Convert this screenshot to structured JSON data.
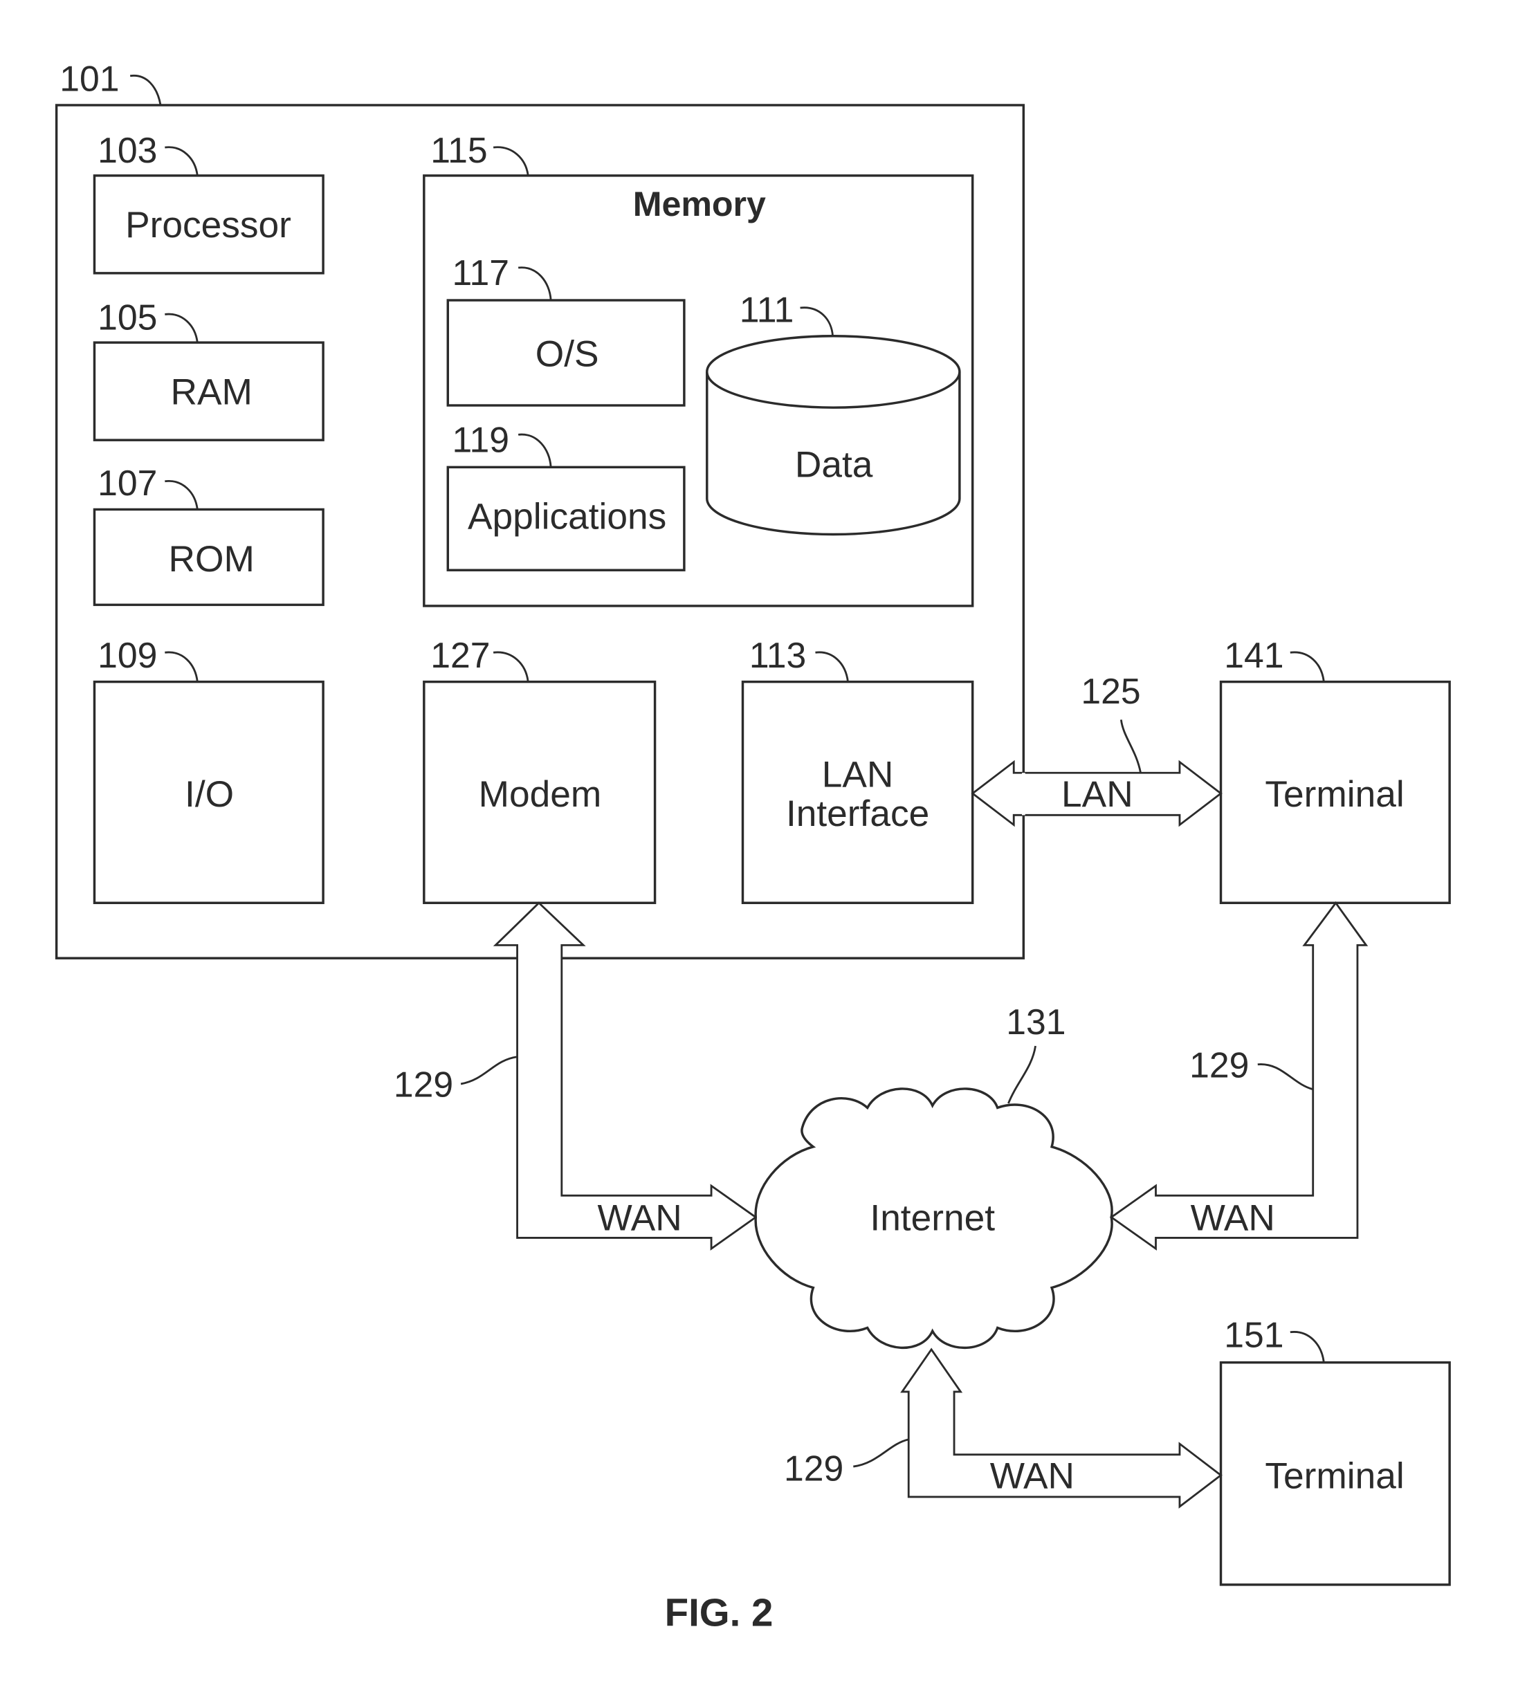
{
  "figure": {
    "caption": "FIG. 2"
  },
  "computer": {
    "ref": "101",
    "components": {
      "processor": {
        "ref": "103",
        "label": "Processor"
      },
      "ram": {
        "ref": "105",
        "label": "RAM"
      },
      "rom": {
        "ref": "107",
        "label": "ROM"
      },
      "io": {
        "ref": "109",
        "label": "I/O"
      },
      "memory": {
        "ref": "115",
        "label": "Memory",
        "os": {
          "ref": "117",
          "label": "O/S"
        },
        "applications": {
          "ref": "119",
          "label": "Applications"
        },
        "data": {
          "ref": "111",
          "label": "Data"
        }
      },
      "modem": {
        "ref": "127",
        "label": "Modem"
      },
      "lan_interface": {
        "ref": "113",
        "label_line1": "LAN",
        "label_line2": "Interface"
      }
    }
  },
  "network": {
    "lan_link": {
      "ref": "125",
      "label": "LAN"
    },
    "wan_links": [
      {
        "ref": "129",
        "label": "WAN"
      },
      {
        "ref": "129",
        "label": "WAN"
      },
      {
        "ref": "129",
        "label": "WAN"
      }
    ],
    "internet": {
      "ref": "131",
      "label": "Internet"
    },
    "terminals": [
      {
        "ref": "141",
        "label": "Terminal"
      },
      {
        "ref": "151",
        "label": "Terminal"
      }
    ]
  }
}
